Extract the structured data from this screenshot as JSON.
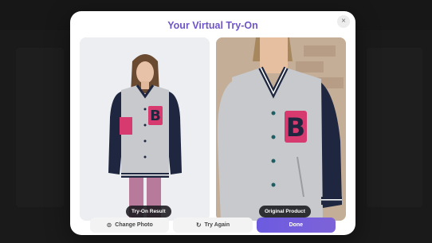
{
  "modal": {
    "title": "Your Virtual Try-On",
    "close_icon": "×"
  },
  "images": {
    "result_label": "Try-On Result",
    "product_label": "Original Product"
  },
  "actions": {
    "change_photo": {
      "label": "Change Photo",
      "icon": "camera-icon",
      "glyph": "⊙"
    },
    "try_again": {
      "label": "Try Again",
      "icon": "refresh-icon",
      "glyph": "↻"
    },
    "done": {
      "label": "Done"
    }
  },
  "colors": {
    "accent": "#6f55c8",
    "primary_button": "#6c5be0",
    "jacket_body": "#c7c9cc",
    "jacket_sleeves": "#1f2740",
    "letter_patch": "#d63a6e"
  }
}
